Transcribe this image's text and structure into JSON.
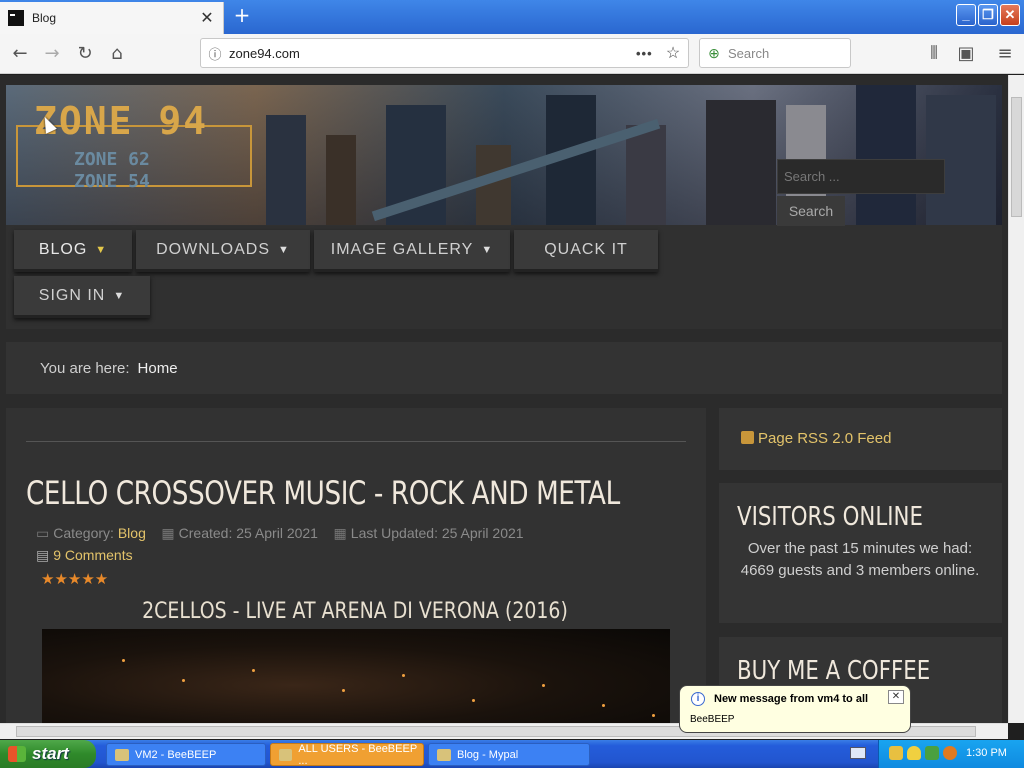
{
  "browser": {
    "tab_title": "Blog",
    "url": "zone94.com",
    "search_placeholder": "Search"
  },
  "site": {
    "logo_main": "ZONE 94",
    "logo_sub1": "ZONE 62",
    "logo_sub2": "ZONE 54",
    "menu": [
      {
        "label": "BLOG"
      },
      {
        "label": "DOWNLOADS"
      },
      {
        "label": "IMAGE GALLERY"
      },
      {
        "label": "QUACK IT"
      },
      {
        "label": "SIGN IN"
      }
    ],
    "search_placeholder": "Search ...",
    "search_button": "Search",
    "breadcrumb_prefix": "You are here:",
    "breadcrumb_home": "Home"
  },
  "article": {
    "title": "CELLO CROSSOVER MUSIC - ROCK AND METAL",
    "category_label": "Category:",
    "category": "Blog",
    "created": "Created: 25 April 2021",
    "updated": "Last Updated: 25 April 2021",
    "comments": "9 Comments",
    "rating": 5,
    "stars": "★★★★★",
    "video_title": "2CELLOS - LIVE AT ARENA DI VERONA (2016)"
  },
  "sidebar": {
    "rss": "Page RSS 2.0 Feed",
    "visitors_title": "VISITORS ONLINE",
    "visitors_text": "Over the past 15 minutes we had: 4669 guests and 3 members online.",
    "coffee_title": "BUY ME A COFFEE"
  },
  "notification": {
    "title": "New message from vm4 to all",
    "body": "BeeBEEP"
  },
  "taskbar": {
    "start": "start",
    "tasks": [
      {
        "label": "VM2 - BeeBEEP"
      },
      {
        "label": "ALL USERS - BeeBEEP ..."
      },
      {
        "label": "Blog - Mypal"
      }
    ],
    "clock": "1:30 PM"
  },
  "colors": {
    "accent_gold": "#e3c36a",
    "star_orange": "#e8892a",
    "page_bg": "#2b2b2b"
  }
}
